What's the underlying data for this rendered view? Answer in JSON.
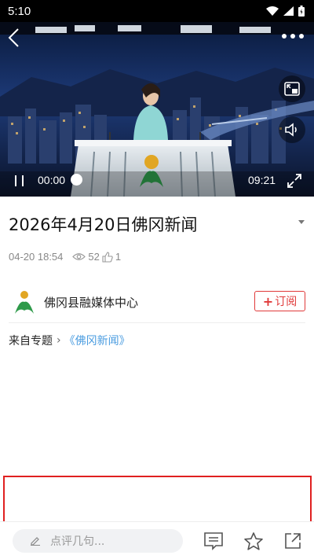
{
  "status_bar": {
    "time": "5:10"
  },
  "video": {
    "current_time": "00:00",
    "total_time": "09:21",
    "progress": 0.0
  },
  "article": {
    "title": "2026年4月20日佛冈新闻",
    "date": "04-20 18:54",
    "views": "52",
    "likes": "1"
  },
  "org": {
    "name": "佛冈县融媒体中心",
    "subscribe_label": "订阅",
    "subscribe_plus": "+"
  },
  "topic": {
    "label": "来自专题",
    "chevron": "›",
    "link": "《佛冈新闻》"
  },
  "bottom_bar": {
    "comment_placeholder": "点评几句..."
  },
  "colors": {
    "accent_red": "#e03a3a",
    "link_blue": "#4a9ce0",
    "highlight_red": "#e02020"
  }
}
